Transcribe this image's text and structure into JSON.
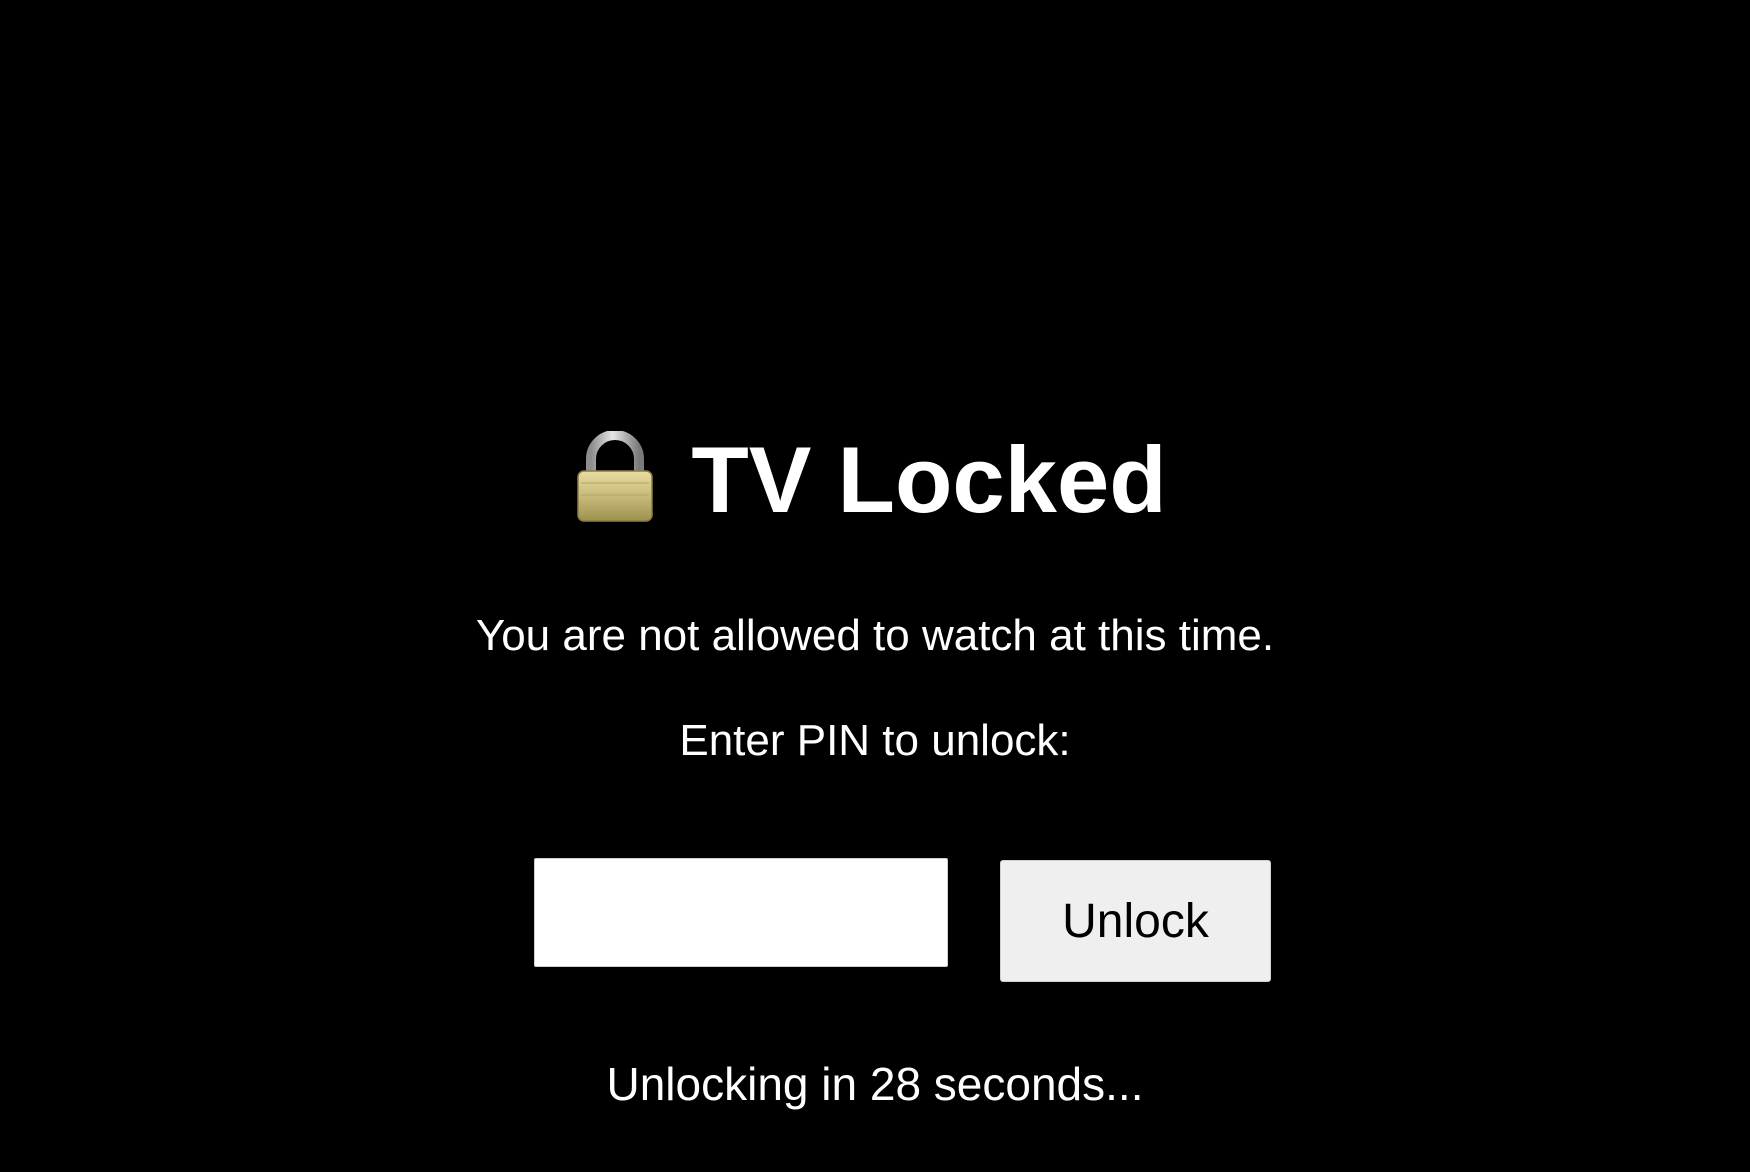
{
  "lock_screen": {
    "icon": "lock-icon",
    "title": "TV Locked",
    "message": "You are not allowed to watch at this time.",
    "pin_prompt": "Enter PIN to unlock:",
    "pin_input_value": "",
    "unlock_button_label": "Unlock",
    "countdown": "Unlocking in 28 seconds...",
    "colors": {
      "background": "#000000",
      "text": "#ffffff",
      "input_background": "#ffffff",
      "button_background": "#efefef"
    }
  }
}
